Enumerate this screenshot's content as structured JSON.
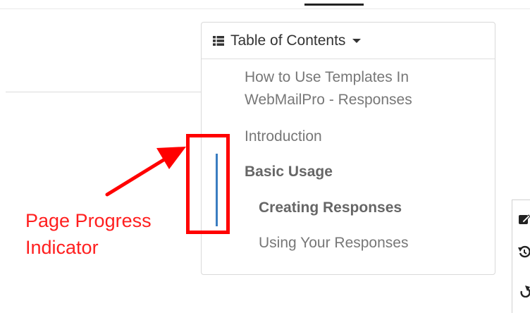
{
  "toc": {
    "title": "Table of Contents",
    "items": [
      {
        "label": "How to Use Templates In",
        "label2": "WebMailPro - Responses"
      },
      {
        "label": "Introduction"
      },
      {
        "label": "Basic Usage"
      },
      {
        "label": "Creating Responses"
      },
      {
        "label": "Using Your Responses"
      }
    ]
  },
  "annotation": {
    "line1": "Page Progress",
    "line2": "Indicator",
    "color": "#ff0000"
  },
  "colors": {
    "progress": "#3a7dc1",
    "text_muted": "#777777"
  },
  "icons": {
    "toc": "list-icon",
    "dropdown": "caret-down-icon",
    "side": [
      "edit-icon",
      "history-icon",
      "share-icon"
    ]
  }
}
